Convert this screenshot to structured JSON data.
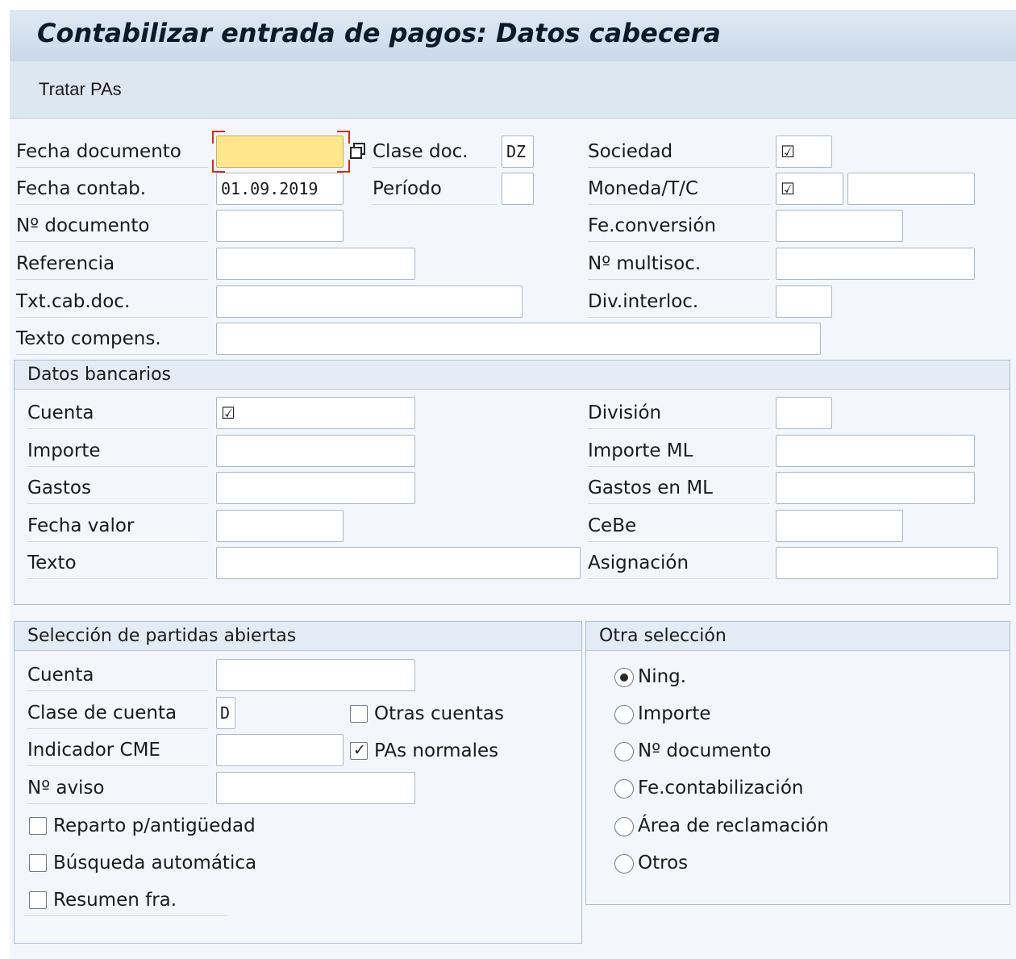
{
  "title": "Contabilizar entrada de pagos: Datos cabecera",
  "toolbar": {
    "tratar_pas": "Tratar PAs"
  },
  "header": {
    "fecha_documento": {
      "label": "Fecha documento",
      "value": ""
    },
    "clase_doc": {
      "label": "Clase doc.",
      "value": "DZ"
    },
    "sociedad": {
      "label": "Sociedad",
      "value": "☑"
    },
    "fecha_contab": {
      "label": "Fecha contab.",
      "value": "01.09.2019"
    },
    "periodo": {
      "label": "Período",
      "value": ""
    },
    "moneda_tc": {
      "label": "Moneda/T/C",
      "value": "☑",
      "value2": ""
    },
    "no_documento": {
      "label": "Nº documento",
      "value": ""
    },
    "fe_conversion": {
      "label": "Fe.conversión",
      "value": ""
    },
    "referencia": {
      "label": "Referencia",
      "value": ""
    },
    "no_multisoc": {
      "label": "Nº multisoc.",
      "value": ""
    },
    "txt_cab_doc": {
      "label": "Txt.cab.doc.",
      "value": ""
    },
    "div_interloc": {
      "label": "Div.interloc.",
      "value": ""
    },
    "texto_compens": {
      "label": "Texto compens.",
      "value": ""
    }
  },
  "datos_bancarios": {
    "title": "Datos bancarios",
    "cuenta": {
      "label": "Cuenta",
      "value": "☑"
    },
    "division": {
      "label": "División",
      "value": ""
    },
    "importe": {
      "label": "Importe",
      "value": ""
    },
    "importe_ml": {
      "label": "Importe ML",
      "value": ""
    },
    "gastos": {
      "label": "Gastos",
      "value": ""
    },
    "gastos_ml": {
      "label": "Gastos en ML",
      "value": ""
    },
    "fecha_valor": {
      "label": "Fecha valor",
      "value": ""
    },
    "cebe": {
      "label": "CeBe",
      "value": ""
    },
    "texto": {
      "label": "Texto",
      "value": ""
    },
    "asignacion": {
      "label": "Asignación",
      "value": ""
    }
  },
  "seleccion_pas": {
    "title": "Selección de partidas abiertas",
    "cuenta": {
      "label": "Cuenta",
      "value": ""
    },
    "clase_cuenta": {
      "label": "Clase de cuenta",
      "value": "D"
    },
    "indicador_cme": {
      "label": "Indicador CME",
      "value": ""
    },
    "no_aviso": {
      "label": "Nº aviso",
      "value": ""
    },
    "otras_cuentas": {
      "label": "Otras cuentas",
      "checked": false
    },
    "pas_normales": {
      "label": "PAs normales",
      "checked": true
    },
    "reparto": {
      "label": "Reparto p/antigüedad",
      "checked": false
    },
    "busqueda": {
      "label": "Búsqueda automática",
      "checked": false
    },
    "resumen": {
      "label": "Resumen fra.",
      "checked": false
    }
  },
  "otra_seleccion": {
    "title": "Otra selección",
    "options": [
      {
        "label": "Ning.",
        "selected": true
      },
      {
        "label": "Importe",
        "selected": false
      },
      {
        "label": "Nº documento",
        "selected": false
      },
      {
        "label": "Fe.contabilización",
        "selected": false
      },
      {
        "label": "Área de reclamación",
        "selected": false
      },
      {
        "label": "Otros",
        "selected": false
      }
    ]
  }
}
